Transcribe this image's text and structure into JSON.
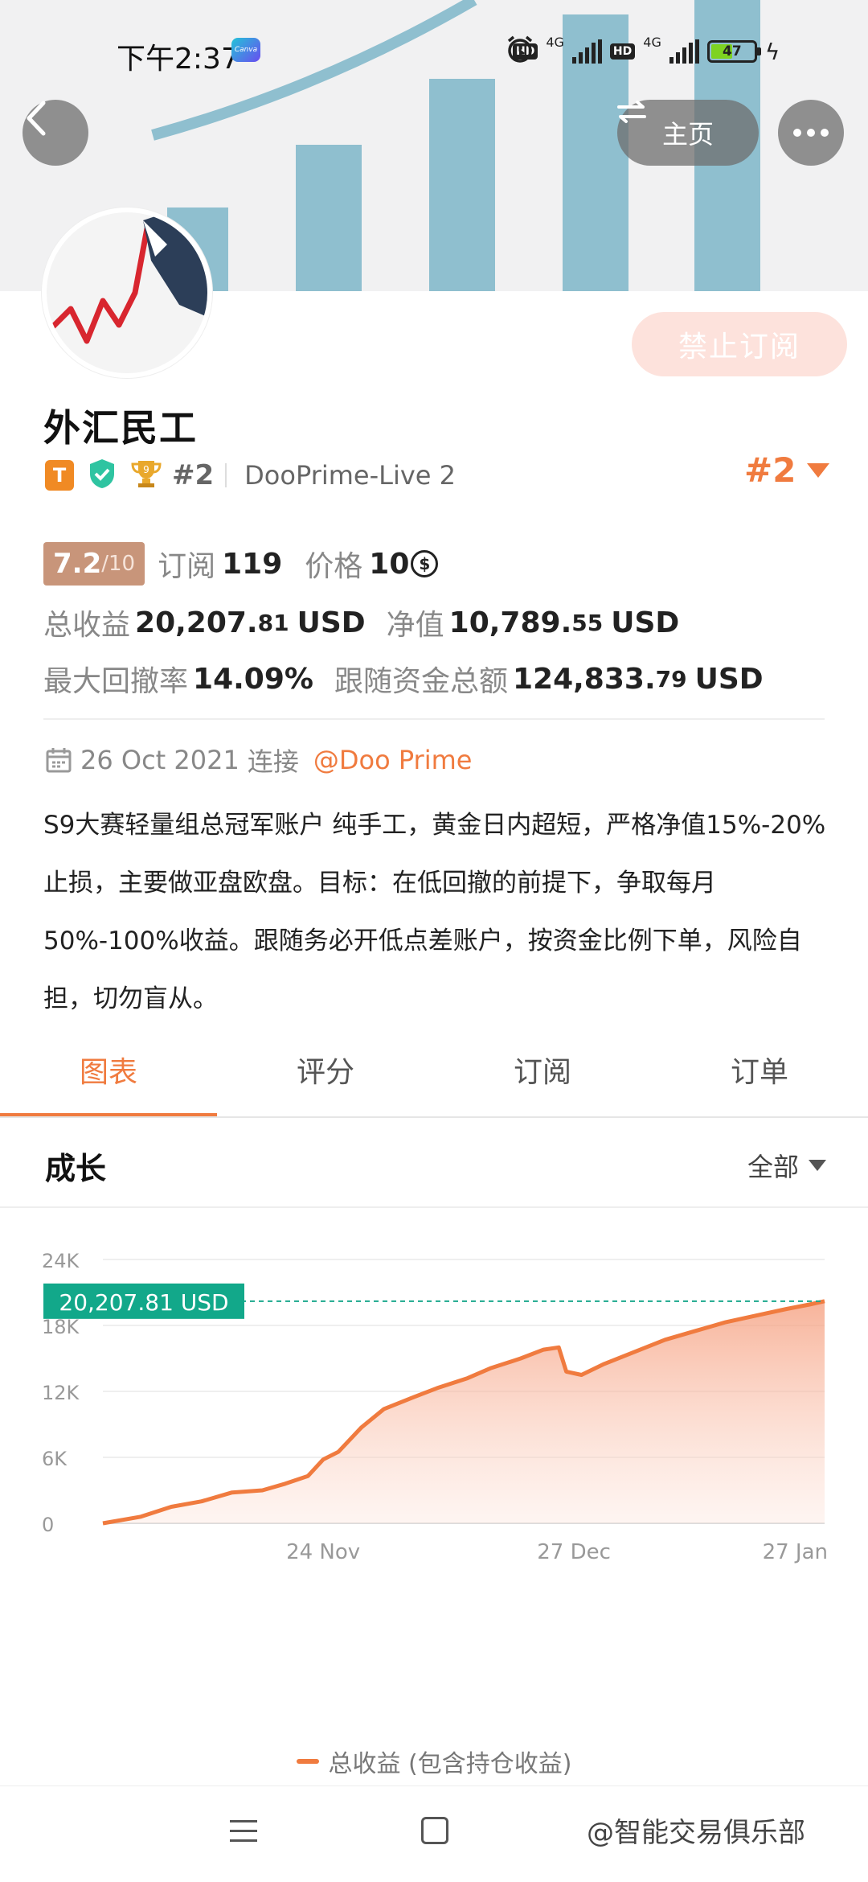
{
  "status_bar": {
    "time": "下午2:37",
    "canva": "Canva",
    "network": "4G",
    "hd": "HD",
    "battery": "47"
  },
  "nav": {
    "home_label": "主页"
  },
  "profile": {
    "subscribe_button": "禁止订阅",
    "name": "外汇民工",
    "badge_t": "T",
    "rank": "#2",
    "server": "DooPrime-Live 2",
    "rank_right": "#2"
  },
  "stats": {
    "score": "7.2",
    "score_den": "/10",
    "subscribe_label": "订阅",
    "subscribe_count": "119",
    "price_label": "价格",
    "price_value": "10",
    "total_profit_label": "总收益",
    "total_profit_main": "20,207.",
    "total_profit_dec": "81",
    "total_profit_unit": "USD",
    "equity_label": "净值",
    "equity_main": "10,789.",
    "equity_dec": "55",
    "equity_unit": "USD",
    "drawdown_label": "最大回撤率",
    "drawdown_value": "14.09%",
    "follow_label": "跟随资金总额",
    "follow_main": "124,833.",
    "follow_dec": "79",
    "follow_unit": "USD"
  },
  "connection": {
    "date": "26 Oct 2021",
    "label": "连接",
    "broker": "@Doo Prime"
  },
  "bio": {
    "line1": "S9大赛轻量组总冠军账户 纯手工，黄金日内超短，严格净值15%-20%",
    "line2": "止损，主要做亚盘欧盘。目标：在低回撤的前提下，争取每月",
    "line3": "50%-100%收益。跟随务必开低点差账户，按资金比例下单，风险自",
    "line4": "担，切勿盲从。"
  },
  "tabs": [
    {
      "label": "图表",
      "active": true
    },
    {
      "label": "评分",
      "active": false
    },
    {
      "label": "订阅",
      "active": false
    },
    {
      "label": "订单",
      "active": false
    }
  ],
  "growth": {
    "title": "成长",
    "filter": "全部"
  },
  "chart_data": {
    "type": "area",
    "series": [
      {
        "name": "总收益 (包含持仓收益)",
        "color": "#f07b3f",
        "x": [
          "2021-10-26",
          "2021-10-31",
          "2021-11-04",
          "2021-11-08",
          "2021-11-12",
          "2021-11-16",
          "2021-11-19",
          "2021-11-22",
          "2021-11-24",
          "2021-11-26",
          "2021-11-29",
          "2021-12-02",
          "2021-12-06",
          "2021-12-09",
          "2021-12-13",
          "2021-12-16",
          "2021-12-20",
          "2021-12-23",
          "2021-12-25",
          "2021-12-26",
          "2021-12-28",
          "2021-12-31",
          "2022-01-04",
          "2022-01-08",
          "2022-01-12",
          "2022-01-16",
          "2022-01-20",
          "2022-01-24",
          "2022-01-27",
          "2022-01-29"
        ],
        "y": [
          0,
          600,
          1500,
          2000,
          2800,
          3000,
          3600,
          4300,
          5800,
          6500,
          8700,
          10400,
          11500,
          12300,
          13200,
          14100,
          15000,
          15800,
          16000,
          13800,
          13500,
          14500,
          15600,
          16700,
          17500,
          18300,
          18900,
          19500,
          19900,
          20207.81
        ]
      }
    ],
    "current_value_label": "20,207.81 USD",
    "current_value": 20207.81,
    "xticks": [
      "24 Nov",
      "27 Dec",
      "27 Jan"
    ],
    "yticks": [
      "0",
      "6K",
      "12K",
      "18K",
      "24K"
    ],
    "ylim": [
      0,
      24000
    ],
    "grid": true,
    "legend": "bottom"
  },
  "watermark": "@智能交易俱乐部"
}
